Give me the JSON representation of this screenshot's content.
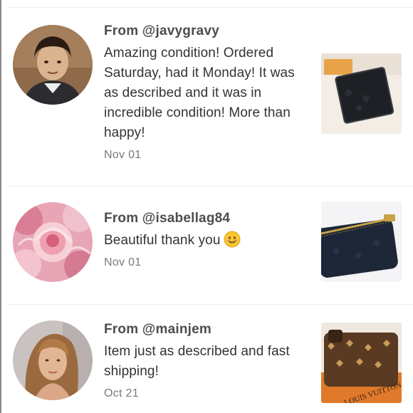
{
  "reviews": [
    {
      "from": "From @javygravy",
      "text": "Amazing condition! Ordered Saturday, had it Monday! It was as described and it was in incredible condition! More than happy!",
      "date": "Nov 01",
      "avatar_icon": "user-avatar-boy",
      "thumb_icon": "black-wallet-photo"
    },
    {
      "from": "From @isabellag84",
      "text": "Beautiful thank you",
      "emoji": "smiling-face-icon",
      "date": "Nov 01",
      "avatar_icon": "user-avatar-roses",
      "thumb_icon": "navy-pouch-photo"
    },
    {
      "from": "From @mainjem",
      "text": "Item just as described and fast shipping!",
      "date": "Oct 21",
      "avatar_icon": "user-avatar-woman",
      "thumb_icon": "monogram-wallet-photo",
      "thumb_brand_text": "LOUIS VUITTON"
    }
  ],
  "colors": {
    "divider": "#ececec",
    "text": "#333333",
    "date": "#7a7a7a",
    "edge": "#8a8a8a"
  }
}
